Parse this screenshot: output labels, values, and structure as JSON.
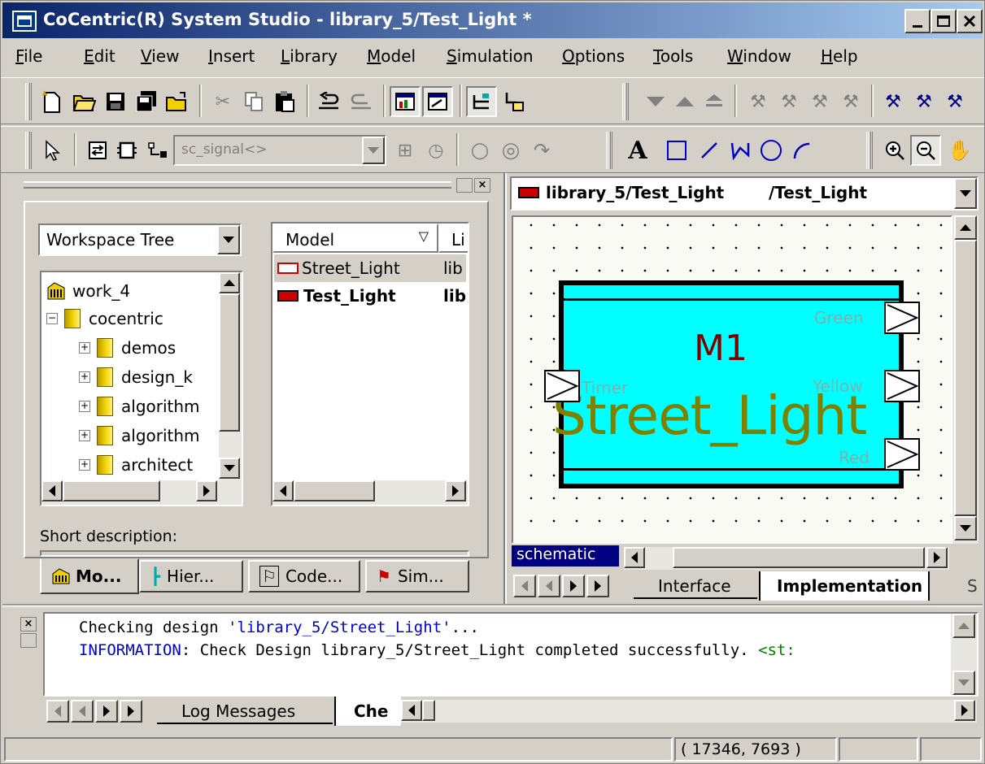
{
  "window": {
    "title": "CoCentric(R) System Studio - library_5/Test_Light *"
  },
  "menu": [
    "File",
    "Edit",
    "View",
    "Insert",
    "Library",
    "Model",
    "Simulation",
    "Options",
    "Tools",
    "Window",
    "Help"
  ],
  "toolbar2": {
    "signal_combo_value": "sc_signal<>",
    "text_tool": "A"
  },
  "workspace": {
    "combo_value": "Workspace Tree",
    "tree": [
      {
        "label": "work_4",
        "icon": "library-icon"
      },
      {
        "label": "cocentric",
        "icon": "folder-icon",
        "expander": "−"
      },
      {
        "label": "demos",
        "icon": "folder-icon",
        "expander": "+"
      },
      {
        "label": "design_k",
        "icon": "folder-icon",
        "expander": "+"
      },
      {
        "label": "algorithm",
        "icon": "folder-icon",
        "expander": "+"
      },
      {
        "label": "algorithm",
        "icon": "folder-icon",
        "expander": "+"
      },
      {
        "label": "architect",
        "icon": "folder-icon",
        "expander": "+"
      }
    ],
    "model_list": {
      "headers": [
        "Model",
        "Li"
      ],
      "rows": [
        {
          "model": "Street_Light",
          "lib": "lib",
          "bold": false
        },
        {
          "model": "Test_Light",
          "lib": "lib",
          "bold": true
        }
      ]
    },
    "short_description_label": "Short description:",
    "tabs": [
      "Mo...",
      "Hier...",
      "Code...",
      "Sim..."
    ],
    "active_tab": 0
  },
  "editor": {
    "path_combo": "library_5/Test_Light",
    "path_combo_suffix": "/Test_Light",
    "block": {
      "instance": "M1",
      "model": "Street_Light",
      "inputs": [
        "Timer"
      ],
      "outputs": [
        "Green",
        "Yellow",
        "Red"
      ]
    },
    "view_label": "schematic",
    "tabs": [
      "Interface",
      "Implementation",
      "S"
    ],
    "active_tab": 1
  },
  "log": {
    "lines": [
      {
        "prefix": "Checking design ",
        "quoted": "'library_5/Street_Light'",
        "suffix": "..."
      },
      {
        "keyword": "INFORMATION",
        "text": ": Check Design library_5/Street_Light completed successfully. ",
        "tail": "<st:"
      }
    ],
    "tabs": [
      "Log Messages",
      "Che"
    ],
    "active_tab": 1
  },
  "status": {
    "coords": "( 17346, 7693 )"
  },
  "colors": {
    "title_start": "#0a246a",
    "block_fill": "#00ffff",
    "model_text": "#7f7f00",
    "instance_text": "#800000",
    "log_keyword": "#0000cc"
  }
}
